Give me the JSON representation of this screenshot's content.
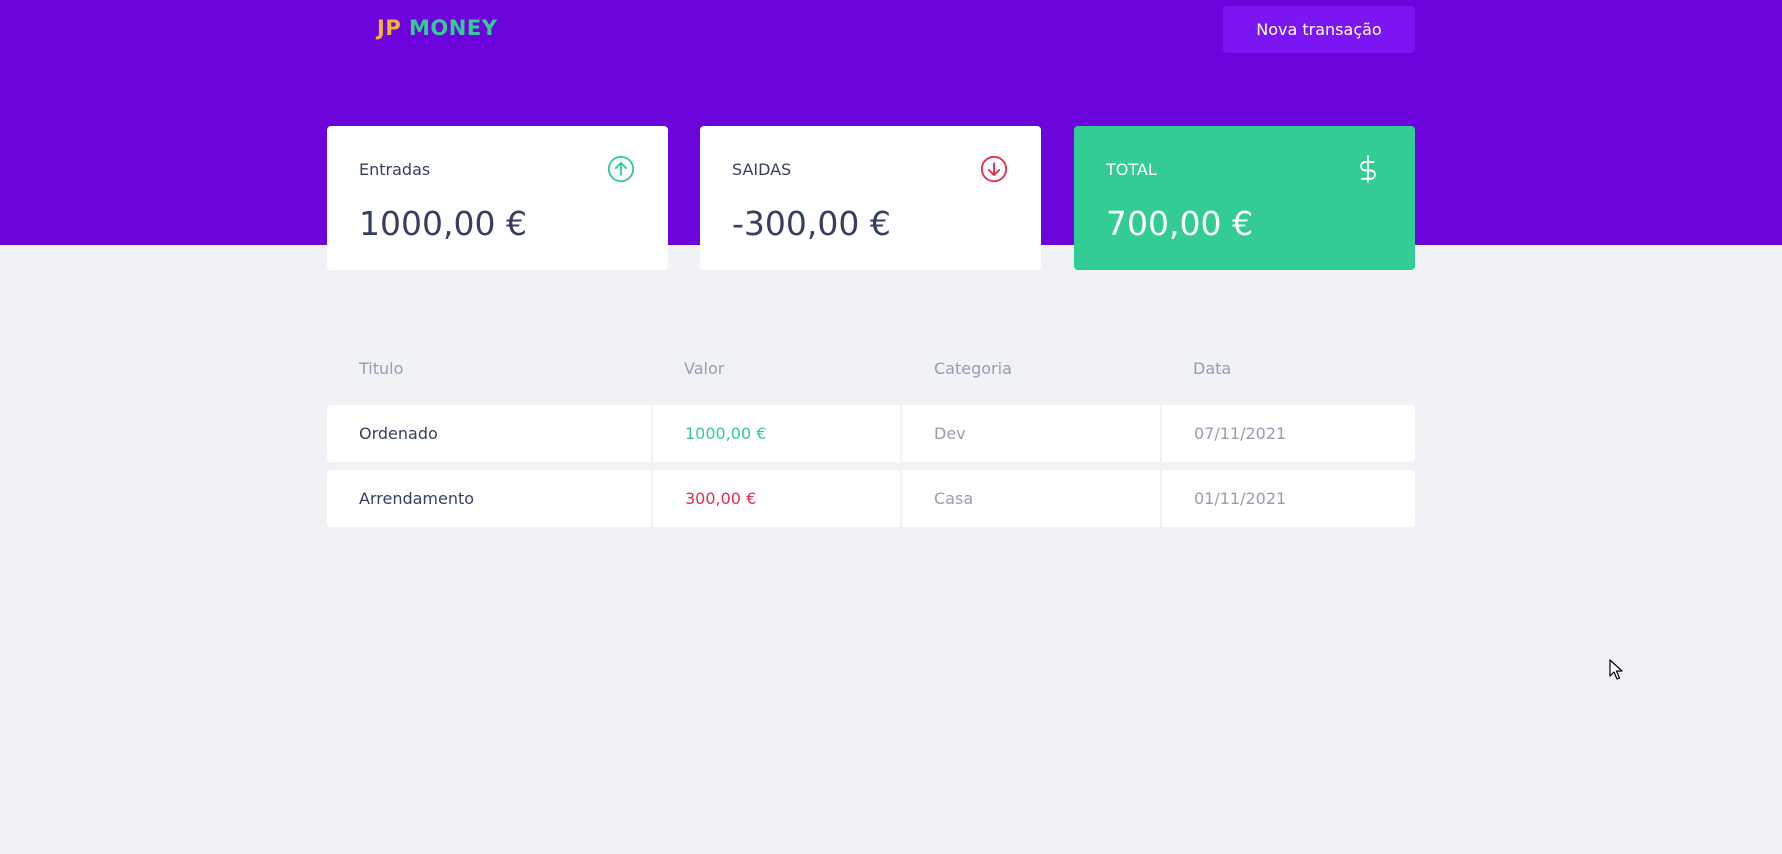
{
  "header": {
    "logo_part1": "JP",
    "logo_part2": "MONEY",
    "new_transaction_label": "Nova transação"
  },
  "summary": {
    "income": {
      "title": "Entradas",
      "value": "1000,00 €",
      "icon": "arrow-circle-up-icon",
      "color": "#33cc95"
    },
    "outcome": {
      "title": "SAIDAS",
      "value": "-300,00 €",
      "icon": "arrow-circle-down-icon",
      "color": "#e52e4d"
    },
    "total": {
      "title": "TOTAL",
      "value": "700,00 €",
      "icon": "dollar-sign-icon",
      "color": "#33cc95"
    }
  },
  "table": {
    "headers": [
      "Titulo",
      "Valor",
      "Categoria",
      "Data"
    ],
    "rows": [
      {
        "title": "Ordenado",
        "amount": "1000,00 €",
        "type": "deposit",
        "category": "Dev",
        "date": "07/11/2021"
      },
      {
        "title": "Arrendamento",
        "amount": "300,00 €",
        "type": "withdraw",
        "category": "Casa",
        "date": "01/11/2021"
      }
    ]
  },
  "colors": {
    "header_bg": "#6e04dc",
    "button_bg": "#7b16f2",
    "green": "#33cc95",
    "red": "#e52e4d",
    "page_bg": "#f0f2f5"
  }
}
